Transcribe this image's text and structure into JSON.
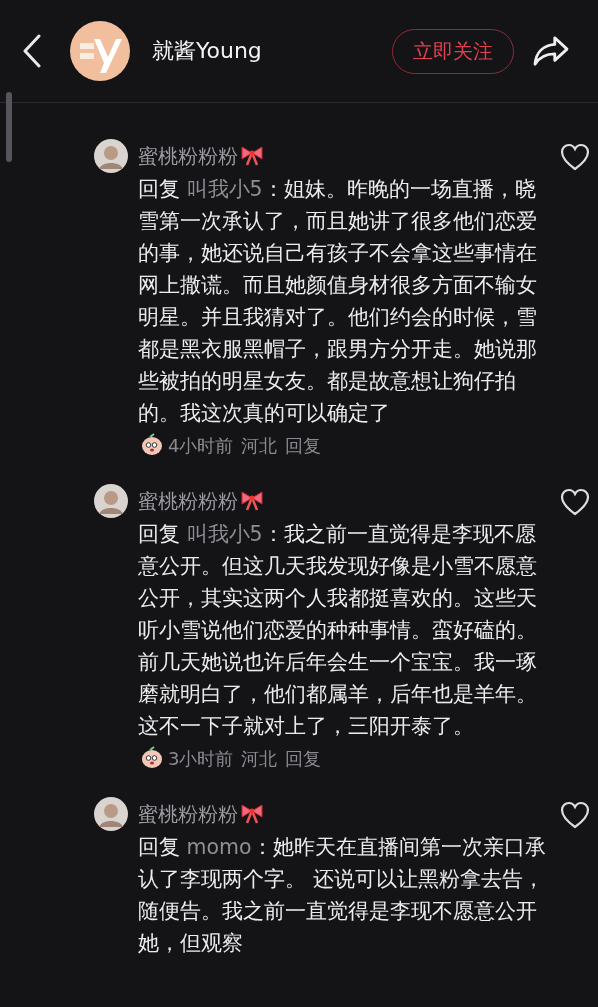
{
  "header": {
    "account_name": "就酱Young",
    "follow_button": "立即关注"
  },
  "comments": [
    {
      "author": "蜜桃粉粉粉",
      "liked": false,
      "reply_label": "回复",
      "reply_to": "叫我小5",
      "text": "：姐妹。昨晚的一场直播，晓雪第一次承认了，而且她讲了很多他们恋爱的事，她还说自己有孩子不会拿这些事情在网上撒谎。而且她颜值身材很多方面不输女明星。并且我猜对了。他们约会的时候，雪都是黑衣服黑帽子，跟男方分开走。她说那些被拍的明星女友。都是故意想让狗仔拍的。我这次真的可以确定了",
      "time": "4小时前",
      "location": "河北",
      "reply_button": "回复"
    },
    {
      "author": "蜜桃粉粉粉",
      "liked": false,
      "reply_label": "回复",
      "reply_to": "叫我小5",
      "text": "：我之前一直觉得是李现不愿意公开。但这几天我发现好像是小雪不愿意公开，其实这两个人我都挺喜欢的。这些天听小雪说他们恋爱的种种事情。蛮好磕的。前几天她说也许后年会生一个宝宝。我一琢磨就明白了，他们都属羊，后年也是羊年。这不一下子就对上了，三阳开泰了。",
      "time": "3小时前",
      "location": "河北",
      "reply_button": "回复"
    },
    {
      "author": "蜜桃粉粉粉",
      "liked": false,
      "reply_label": "回复",
      "reply_to": "momo",
      "text": "：她昨天在直播间第一次亲口承认了李现两个字。 还说可以让黑粉拿去告，随便告。我之前一直觉得是李现不愿意公开她，但观察"
    }
  ]
}
